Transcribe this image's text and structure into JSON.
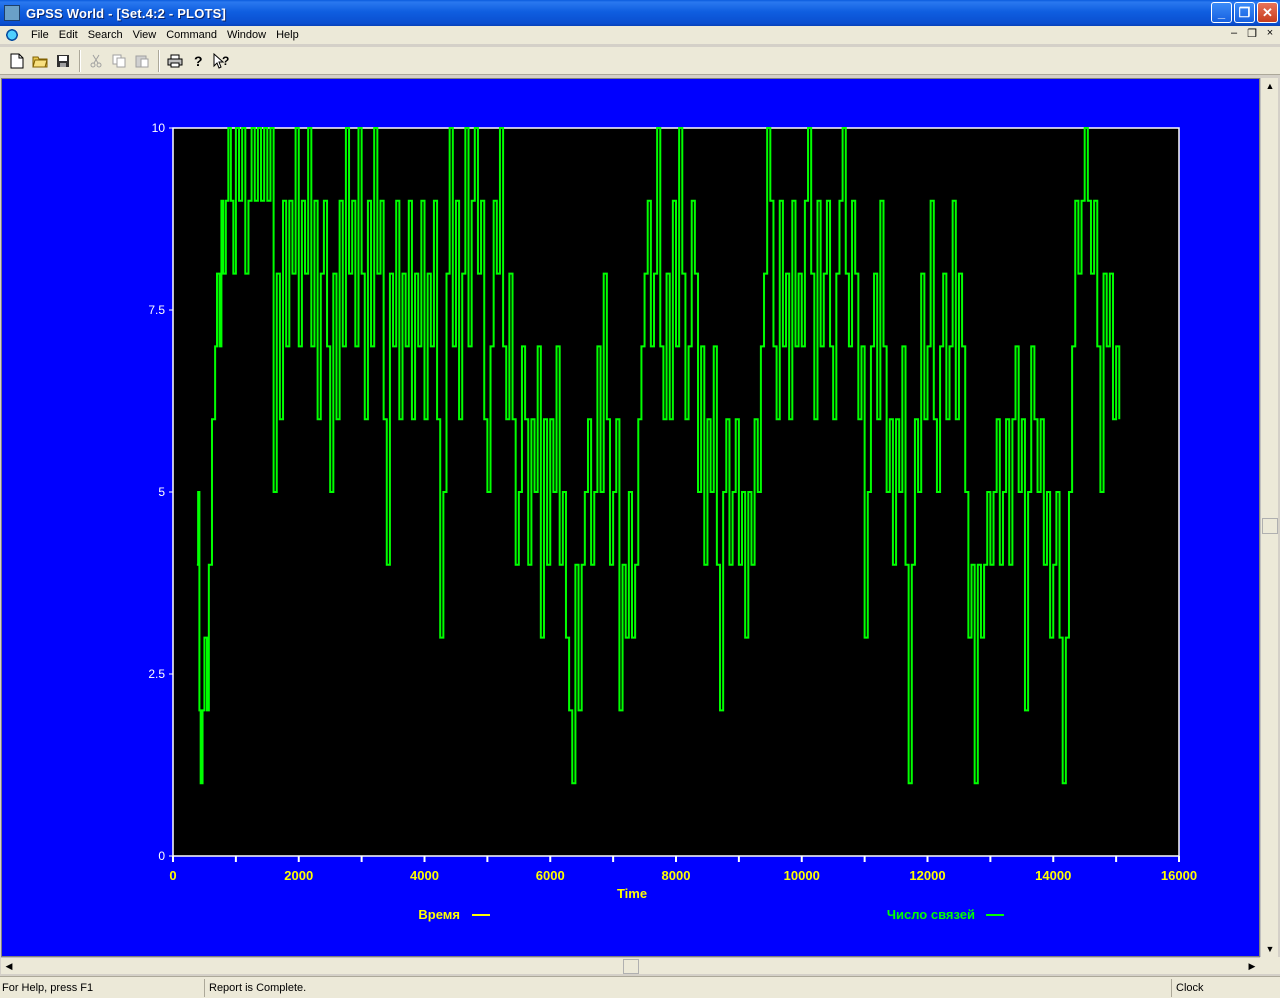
{
  "window": {
    "title": "GPSS World - [Set.4:2  - PLOTS]",
    "minimize": "_",
    "restore": "❐",
    "close": "✕"
  },
  "menu": [
    "File",
    "Edit",
    "Search",
    "View",
    "Command",
    "Window",
    "Help"
  ],
  "mdi": {
    "minimize": "–",
    "restore": "❐",
    "close": "×"
  },
  "toolbar": {
    "icons": [
      "new-file-icon",
      "open-folder-icon",
      "save-icon",
      "cut-icon",
      "copy-icon",
      "paste-icon",
      "print-icon",
      "help-icon",
      "context-help-icon"
    ]
  },
  "chart_data": {
    "type": "line",
    "xlabel": "Time",
    "xlim": [
      0,
      16000
    ],
    "ylim": [
      0,
      10
    ],
    "x_ticks": [
      "0",
      "2000",
      "4000",
      "6000",
      "8000",
      "10000",
      "12000",
      "14000",
      "16000"
    ],
    "y_ticks": [
      "0",
      "2.5",
      "5",
      "7.5",
      "10"
    ],
    "series": [
      {
        "name": "Время",
        "color": "#ffff00",
        "values": []
      },
      {
        "name": "Число связей",
        "color": "#00ff00",
        "step": true,
        "points": [
          [
            380,
            4
          ],
          [
            400,
            5
          ],
          [
            420,
            2
          ],
          [
            440,
            1
          ],
          [
            470,
            2
          ],
          [
            500,
            3
          ],
          [
            540,
            2
          ],
          [
            570,
            4
          ],
          [
            620,
            6
          ],
          [
            670,
            7
          ],
          [
            700,
            8
          ],
          [
            740,
            7
          ],
          [
            770,
            9
          ],
          [
            800,
            8
          ],
          [
            840,
            9
          ],
          [
            880,
            10
          ],
          [
            920,
            9
          ],
          [
            960,
            8
          ],
          [
            1000,
            10
          ],
          [
            1050,
            9
          ],
          [
            1100,
            10
          ],
          [
            1150,
            8
          ],
          [
            1200,
            9
          ],
          [
            1250,
            10
          ],
          [
            1300,
            9
          ],
          [
            1350,
            10
          ],
          [
            1400,
            9
          ],
          [
            1450,
            10
          ],
          [
            1500,
            9
          ],
          [
            1550,
            10
          ],
          [
            1600,
            5
          ],
          [
            1650,
            8
          ],
          [
            1700,
            6
          ],
          [
            1750,
            9
          ],
          [
            1800,
            7
          ],
          [
            1850,
            9
          ],
          [
            1900,
            8
          ],
          [
            1950,
            10
          ],
          [
            2000,
            7
          ],
          [
            2050,
            9
          ],
          [
            2100,
            8
          ],
          [
            2150,
            10
          ],
          [
            2200,
            7
          ],
          [
            2250,
            9
          ],
          [
            2300,
            6
          ],
          [
            2350,
            8
          ],
          [
            2400,
            9
          ],
          [
            2450,
            7
          ],
          [
            2500,
            5
          ],
          [
            2550,
            8
          ],
          [
            2600,
            6
          ],
          [
            2650,
            9
          ],
          [
            2700,
            7
          ],
          [
            2750,
            10
          ],
          [
            2800,
            8
          ],
          [
            2850,
            9
          ],
          [
            2900,
            7
          ],
          [
            2950,
            10
          ],
          [
            3000,
            8
          ],
          [
            3050,
            6
          ],
          [
            3100,
            9
          ],
          [
            3150,
            7
          ],
          [
            3200,
            10
          ],
          [
            3250,
            8
          ],
          [
            3300,
            9
          ],
          [
            3350,
            6
          ],
          [
            3400,
            4
          ],
          [
            3450,
            8
          ],
          [
            3500,
            7
          ],
          [
            3550,
            9
          ],
          [
            3600,
            6
          ],
          [
            3650,
            8
          ],
          [
            3700,
            7
          ],
          [
            3750,
            9
          ],
          [
            3800,
            6
          ],
          [
            3850,
            8
          ],
          [
            3900,
            7
          ],
          [
            3950,
            9
          ],
          [
            4000,
            6
          ],
          [
            4050,
            8
          ],
          [
            4100,
            7
          ],
          [
            4150,
            9
          ],
          [
            4200,
            6
          ],
          [
            4250,
            3
          ],
          [
            4300,
            5
          ],
          [
            4350,
            8
          ],
          [
            4400,
            10
          ],
          [
            4450,
            7
          ],
          [
            4500,
            9
          ],
          [
            4550,
            6
          ],
          [
            4600,
            8
          ],
          [
            4650,
            10
          ],
          [
            4700,
            7
          ],
          [
            4750,
            9
          ],
          [
            4800,
            10
          ],
          [
            4850,
            8
          ],
          [
            4900,
            9
          ],
          [
            4950,
            6
          ],
          [
            5000,
            5
          ],
          [
            5050,
            7
          ],
          [
            5100,
            9
          ],
          [
            5150,
            8
          ],
          [
            5200,
            10
          ],
          [
            5250,
            7
          ],
          [
            5300,
            6
          ],
          [
            5350,
            8
          ],
          [
            5400,
            6
          ],
          [
            5450,
            4
          ],
          [
            5500,
            5
          ],
          [
            5550,
            7
          ],
          [
            5600,
            6
          ],
          [
            5650,
            4
          ],
          [
            5700,
            6
          ],
          [
            5750,
            5
          ],
          [
            5800,
            7
          ],
          [
            5850,
            3
          ],
          [
            5900,
            6
          ],
          [
            5950,
            4
          ],
          [
            6000,
            6
          ],
          [
            6050,
            5
          ],
          [
            6100,
            7
          ],
          [
            6150,
            4
          ],
          [
            6200,
            5
          ],
          [
            6250,
            3
          ],
          [
            6300,
            2
          ],
          [
            6350,
            1
          ],
          [
            6400,
            4
          ],
          [
            6450,
            2
          ],
          [
            6500,
            4
          ],
          [
            6550,
            5
          ],
          [
            6600,
            6
          ],
          [
            6650,
            4
          ],
          [
            6700,
            5
          ],
          [
            6750,
            7
          ],
          [
            6800,
            5
          ],
          [
            6850,
            8
          ],
          [
            6900,
            6
          ],
          [
            6950,
            4
          ],
          [
            7000,
            5
          ],
          [
            7050,
            6
          ],
          [
            7100,
            2
          ],
          [
            7150,
            4
          ],
          [
            7200,
            3
          ],
          [
            7250,
            5
          ],
          [
            7300,
            3
          ],
          [
            7350,
            4
          ],
          [
            7400,
            6
          ],
          [
            7450,
            7
          ],
          [
            7500,
            8
          ],
          [
            7550,
            9
          ],
          [
            7600,
            7
          ],
          [
            7650,
            8
          ],
          [
            7700,
            10
          ],
          [
            7750,
            7
          ],
          [
            7800,
            6
          ],
          [
            7850,
            8
          ],
          [
            7900,
            6
          ],
          [
            7950,
            9
          ],
          [
            8000,
            7
          ],
          [
            8050,
            10
          ],
          [
            8100,
            8
          ],
          [
            8150,
            6
          ],
          [
            8200,
            7
          ],
          [
            8250,
            9
          ],
          [
            8300,
            8
          ],
          [
            8350,
            5
          ],
          [
            8400,
            7
          ],
          [
            8450,
            4
          ],
          [
            8500,
            6
          ],
          [
            8550,
            5
          ],
          [
            8600,
            7
          ],
          [
            8650,
            4
          ],
          [
            8700,
            2
          ],
          [
            8750,
            5
          ],
          [
            8800,
            6
          ],
          [
            8850,
            4
          ],
          [
            8900,
            5
          ],
          [
            8950,
            6
          ],
          [
            9000,
            4
          ],
          [
            9050,
            5
          ],
          [
            9100,
            3
          ],
          [
            9150,
            5
          ],
          [
            9200,
            4
          ],
          [
            9250,
            6
          ],
          [
            9300,
            5
          ],
          [
            9350,
            7
          ],
          [
            9400,
            8
          ],
          [
            9450,
            10
          ],
          [
            9500,
            9
          ],
          [
            9550,
            7
          ],
          [
            9600,
            6
          ],
          [
            9650,
            9
          ],
          [
            9700,
            7
          ],
          [
            9750,
            8
          ],
          [
            9800,
            6
          ],
          [
            9850,
            9
          ],
          [
            9900,
            7
          ],
          [
            9950,
            8
          ],
          [
            10000,
            7
          ],
          [
            10050,
            9
          ],
          [
            10100,
            10
          ],
          [
            10150,
            8
          ],
          [
            10200,
            6
          ],
          [
            10250,
            9
          ],
          [
            10300,
            7
          ],
          [
            10350,
            8
          ],
          [
            10400,
            9
          ],
          [
            10450,
            7
          ],
          [
            10500,
            6
          ],
          [
            10550,
            8
          ],
          [
            10600,
            9
          ],
          [
            10650,
            10
          ],
          [
            10700,
            8
          ],
          [
            10750,
            7
          ],
          [
            10800,
            9
          ],
          [
            10850,
            8
          ],
          [
            10900,
            6
          ],
          [
            10950,
            7
          ],
          [
            11000,
            3
          ],
          [
            11050,
            5
          ],
          [
            11100,
            7
          ],
          [
            11150,
            8
          ],
          [
            11200,
            6
          ],
          [
            11250,
            9
          ],
          [
            11300,
            7
          ],
          [
            11350,
            5
          ],
          [
            11400,
            6
          ],
          [
            11450,
            4
          ],
          [
            11500,
            6
          ],
          [
            11550,
            5
          ],
          [
            11600,
            7
          ],
          [
            11650,
            4
          ],
          [
            11700,
            1
          ],
          [
            11750,
            4
          ],
          [
            11800,
            6
          ],
          [
            11850,
            5
          ],
          [
            11900,
            8
          ],
          [
            11950,
            6
          ],
          [
            12000,
            7
          ],
          [
            12050,
            9
          ],
          [
            12100,
            6
          ],
          [
            12150,
            5
          ],
          [
            12200,
            7
          ],
          [
            12250,
            8
          ],
          [
            12300,
            6
          ],
          [
            12350,
            7
          ],
          [
            12400,
            9
          ],
          [
            12450,
            6
          ],
          [
            12500,
            8
          ],
          [
            12550,
            7
          ],
          [
            12600,
            5
          ],
          [
            12650,
            3
          ],
          [
            12700,
            4
          ],
          [
            12750,
            1
          ],
          [
            12800,
            4
          ],
          [
            12850,
            3
          ],
          [
            12900,
            4
          ],
          [
            12950,
            5
          ],
          [
            13000,
            4
          ],
          [
            13050,
            5
          ],
          [
            13100,
            6
          ],
          [
            13150,
            4
          ],
          [
            13200,
            5
          ],
          [
            13250,
            6
          ],
          [
            13300,
            4
          ],
          [
            13350,
            6
          ],
          [
            13400,
            7
          ],
          [
            13450,
            5
          ],
          [
            13500,
            6
          ],
          [
            13550,
            2
          ],
          [
            13600,
            5
          ],
          [
            13650,
            7
          ],
          [
            13700,
            6
          ],
          [
            13750,
            5
          ],
          [
            13800,
            6
          ],
          [
            13850,
            4
          ],
          [
            13900,
            5
          ],
          [
            13950,
            3
          ],
          [
            14000,
            4
          ],
          [
            14050,
            5
          ],
          [
            14100,
            3
          ],
          [
            14150,
            1
          ],
          [
            14200,
            3
          ],
          [
            14250,
            5
          ],
          [
            14300,
            7
          ],
          [
            14350,
            9
          ],
          [
            14400,
            8
          ],
          [
            14450,
            9
          ],
          [
            14500,
            10
          ],
          [
            14550,
            9
          ],
          [
            14600,
            8
          ],
          [
            14650,
            9
          ],
          [
            14700,
            7
          ],
          [
            14750,
            5
          ],
          [
            14800,
            8
          ],
          [
            14850,
            7
          ],
          [
            14900,
            8
          ],
          [
            14950,
            6
          ],
          [
            15000,
            7
          ],
          [
            15050,
            6
          ]
        ]
      }
    ],
    "legend": "bottom",
    "background": "#000000",
    "plot_background": "#0000ff",
    "grid": false
  },
  "status": {
    "help": "For Help, press F1",
    "report": "Report is Complete.",
    "clock": "Clock"
  }
}
